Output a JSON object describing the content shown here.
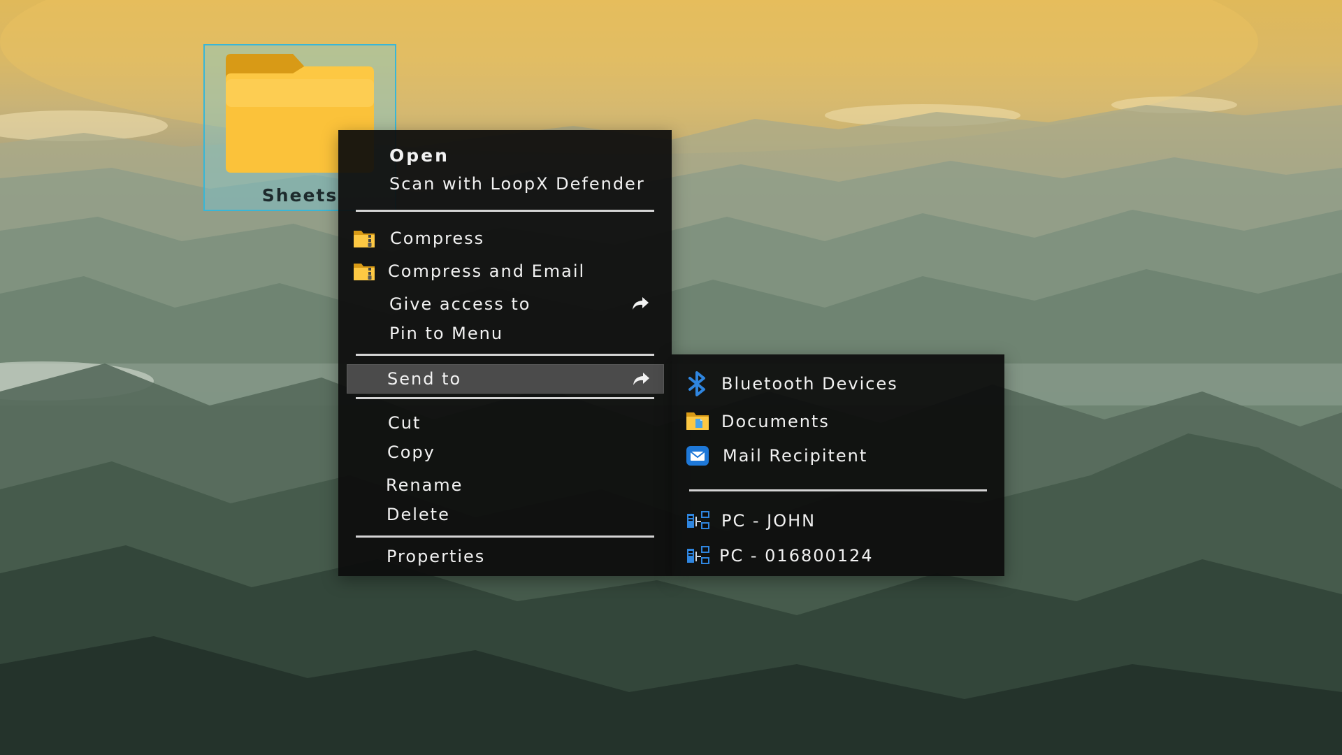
{
  "desktop": {
    "icon": {
      "label": "Sheets",
      "icon": "folder-icon"
    }
  },
  "context_menu": {
    "open": "Open",
    "scan": "Scan with LoopX Defender",
    "compress": "Compress",
    "compress_email": "Compress and Email",
    "give_access": "Give access to",
    "pin_menu": "Pin to Menu",
    "send_to": "Send to",
    "cut": "Cut",
    "copy": "Copy",
    "rename": "Rename",
    "delete": "Delete",
    "properties": "Properties"
  },
  "send_to_submenu": {
    "bluetooth": "Bluetooth Devices",
    "documents": "Documents",
    "mail": "Mail Recipitent",
    "pc_john": "PC - JOHN",
    "pc_number": "PC - 016800124"
  },
  "icons": {
    "compress": "zip-folder-icon",
    "compress_email": "zip-folder-icon",
    "give_access": "share-arrow-icon",
    "send_to": "share-arrow-icon",
    "bluetooth": "bluetooth-icon",
    "documents": "documents-folder-icon",
    "mail": "mail-icon",
    "pc": "network-pc-icon"
  },
  "colors": {
    "folder_front": "#fdc843",
    "folder_back": "#d89a16",
    "selection_border": "#39b6d6",
    "menu_bg": "#0c0c0c",
    "highlight": "#4b4b4b",
    "accent_blue": "#1e78d8"
  }
}
